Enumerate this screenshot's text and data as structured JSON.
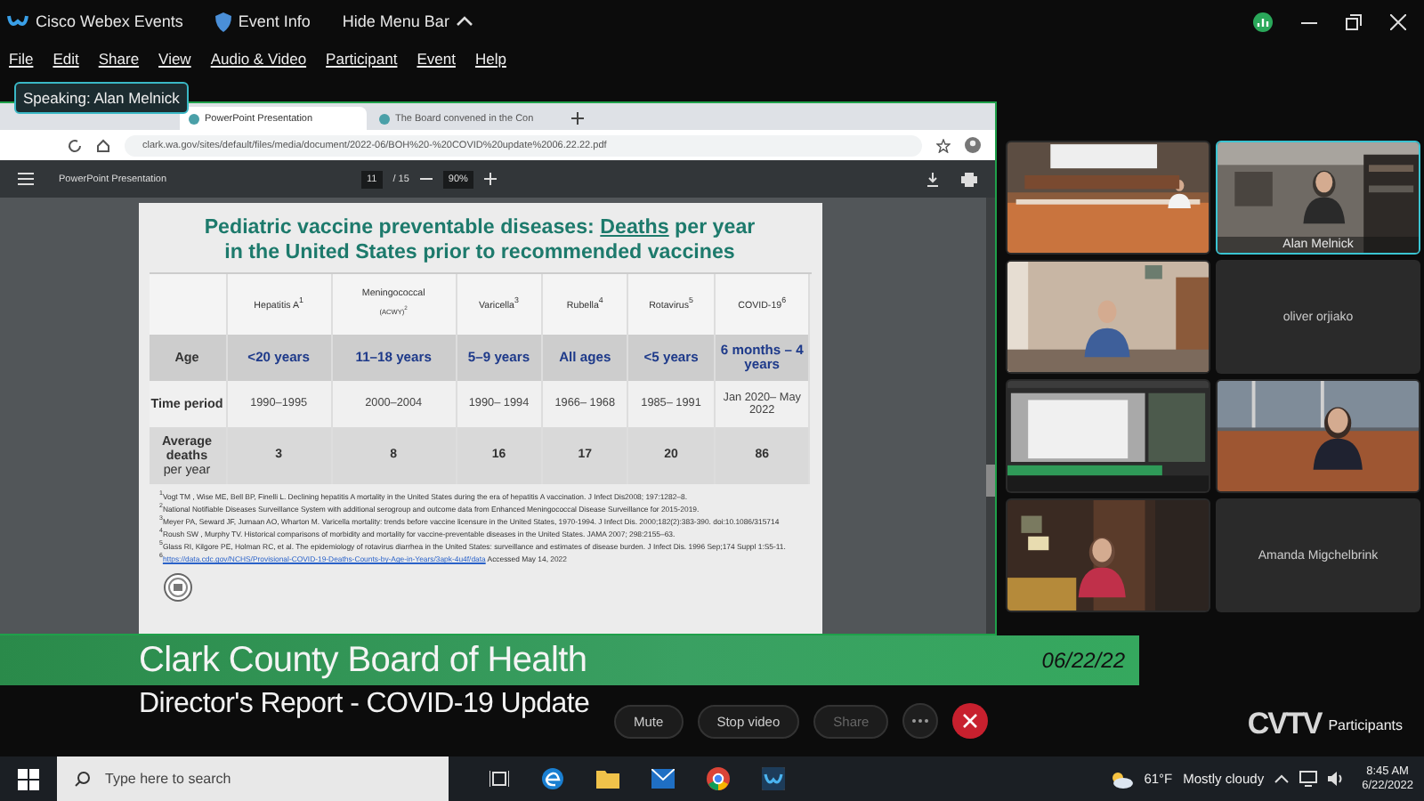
{
  "app_bar": {
    "title": "Cisco Webex Events",
    "event_info": "Event Info",
    "hide_menu": "Hide Menu Bar"
  },
  "menu": [
    "File",
    "Edit",
    "Share",
    "View",
    "Audio & Video",
    "Participant",
    "Event",
    "Help"
  ],
  "speaking": {
    "label": "Speaking:",
    "name": "Alan Melnick"
  },
  "browser": {
    "tabs": [
      {
        "title": "PowerPoint Presentation",
        "selected": true
      },
      {
        "title": "The Board convened in the Con",
        "selected": false
      }
    ],
    "url": "clark.wa.gov/sites/default/files/media/document/2022-06/BOH%20-%20COVID%20update%2006.22.22.pdf",
    "pdf_title": "PowerPoint Presentation",
    "page": "11",
    "pages": "/ 15",
    "zoom": "90%"
  },
  "slide": {
    "title_before": "Pediatric vaccine preventable diseases:",
    "title_underlined": "Deaths",
    "title_after": "per year in the United States prior to recommended vaccines",
    "columns": [
      "Hepatitis A$^{1}$",
      "Meningococcal",
      "Varicella$^{3}$",
      "Rubella$^{4}$",
      "Rotavirus$^{5}$",
      "COVID-19$^{6}$"
    ],
    "column_note": "(ACWY)$^{2}$",
    "rows": [
      {
        "kind": "age",
        "label": "Age",
        "cells": [
          "<20 years",
          "11–18 years",
          "5–9 years",
          "All ages",
          "<5 years",
          "6 months – 4 years"
        ]
      },
      {
        "kind": "period",
        "label": "Time period",
        "cells": [
          "1990–1995",
          "2000–2004",
          "1990– 1994",
          "1966– 1968",
          "1985– 1991",
          "Jan 2020– May 2022"
        ]
      },
      {
        "kind": "deaths",
        "label": "Average deaths",
        "label_note": "per year",
        "cells": [
          "3",
          "8",
          "16",
          "17",
          "20",
          "86"
        ]
      }
    ],
    "footnotes": [
      "$^{1}$Vogt TM , Wise ME, Bell BP, Finelli L. Declining hepatitis A mortality in the United States during the era of hepatitis A vaccination. J Infect Dis2008; 197:1282–8.",
      "$^{2}$National Notifiable Diseases Surveillance System with additional serogroup and outcome data from Enhanced Meningococcal Disease Surveillance for 2015-2019.",
      "$^{3}$Meyer PA, Seward JF, Jumaan AO, Wharton M. Varicella mortality: trends before vaccine licensure in the United States, 1970-1994. J Infect Dis. 2000;182(2):383-390. doi:10.1086/315714",
      "$^{4}$Roush SW , Murphy TV. Historical comparisons of morbidity and mortality for vaccine-preventable diseases in the United States. JAMA 2007; 298:2155–63.",
      "$^{5}$Glass RI, Kilgore PE, Holman RC, et al. The epidemiology of rotavirus diarrhea in the United States: surveillance and estimates of disease burden. J Infect Dis. 1996 Sep;174 Suppl 1:S5-11."
    ],
    "source_mark": "6",
    "source_link": "https://data.cdc.gov/NCHS/Provisional-COVID-19-Deaths-Counts-by-Age-in-Years/3apk-4u4f/data",
    "source_note": "Accessed May 14, 2022"
  },
  "tiles": [
    {
      "kind": "picture",
      "selected": false
    },
    {
      "kind": "picture",
      "name": "Alan Melnick",
      "selected": true
    },
    {
      "kind": "picture",
      "selected": false
    },
    {
      "kind": "name",
      "name": "oliver orjiako",
      "selected": false
    },
    {
      "kind": "picture",
      "selected": false
    },
    {
      "kind": "picture",
      "selected": false
    },
    {
      "kind": "picture",
      "selected": false
    },
    {
      "kind": "name",
      "name": "Amanda Migchelbrink",
      "selected": false
    }
  ],
  "lower_third": {
    "title": "Clark County Board of Health",
    "subtitle": "Director's Report - COVID-19 Update",
    "date": "06/22/22",
    "logo": "CVTV"
  },
  "controls": {
    "mute": "Mute",
    "video": "Stop video",
    "share": "Share",
    "participants": "Participants"
  },
  "taskbar": {
    "search_placeholder": "Type here to search",
    "weather": "61°F",
    "forecast": "Mostly cloudy",
    "time": "8:45 AM",
    "date": "6/22/2022"
  }
}
